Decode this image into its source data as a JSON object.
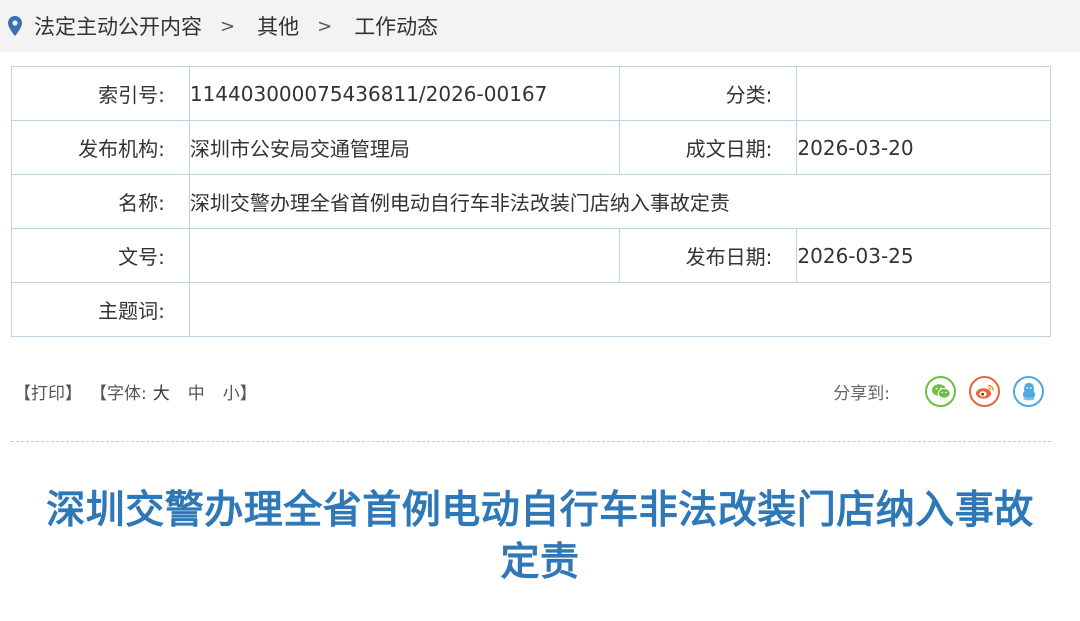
{
  "breadcrumb": {
    "icon": "location-pin-icon",
    "items": [
      "法定主动公开内容",
      "其他",
      "工作动态"
    ],
    "separator": ">"
  },
  "meta": {
    "index_label": "索引号:",
    "index_value": "114403000075436811/2026-00167",
    "category_label": "分类:",
    "category_value": "",
    "publisher_label": "发布机构:",
    "publisher_value": "深圳市公安局交通管理局",
    "created_label": "成文日期:",
    "created_value": "2026-03-20",
    "name_label": "名称:",
    "name_value": "深圳交警办理全省首例电动自行车非法改装门店纳入事故定责",
    "docno_label": "文号:",
    "docno_value": "",
    "published_label": "发布日期:",
    "published_value": "2026-03-25",
    "keywords_label": "主题词:",
    "keywords_value": ""
  },
  "toolbar": {
    "print": "【打印】",
    "font_prefix": "【字体:",
    "font_large": "大",
    "font_medium": "中",
    "font_small": "小",
    "font_suffix": "】",
    "share_label": "分享到:",
    "share_icons": [
      "wechat-icon",
      "weibo-icon",
      "qq-icon"
    ],
    "colors": {
      "wechat": "#6cbf45",
      "weibo": "#e8663a",
      "qq": "#4fa8de"
    }
  },
  "article": {
    "title_line1": "深圳交警办理全省首例电动自行车非法改装门店纳入事故",
    "title_line2": "定责"
  }
}
